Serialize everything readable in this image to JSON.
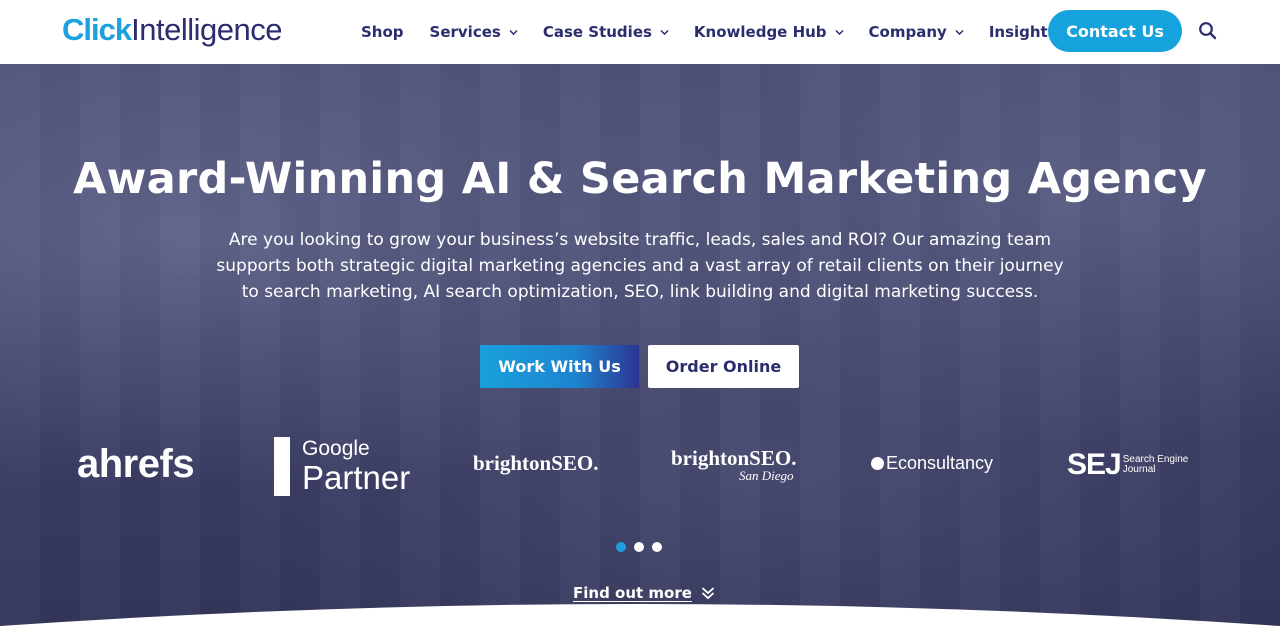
{
  "header": {
    "logo_click": "Click",
    "logo_intel": "Intelligence",
    "nav": [
      {
        "label": "Shop",
        "has_dropdown": false
      },
      {
        "label": "Services",
        "has_dropdown": true
      },
      {
        "label": "Case Studies",
        "has_dropdown": true
      },
      {
        "label": "Knowledge Hub",
        "has_dropdown": true
      },
      {
        "label": "Company",
        "has_dropdown": true
      },
      {
        "label": "Insights",
        "has_dropdown": true
      }
    ],
    "contact_label": "Contact Us",
    "search_icon": "search-icon"
  },
  "hero": {
    "title": "Award-Winning AI & Search Marketing Agency",
    "subtitle": "Are you looking to grow your business’s website traffic, leads, sales and ROI? Our amazing team supports both strategic digital marketing agencies and a vast array of retail clients on their journey to search marketing, AI search optimization, SEO, link building and digital marketing success.",
    "primary_button": "Work With Us",
    "secondary_button": "Order Online",
    "partners": {
      "ahrefs": "ahrefs",
      "google_top": "Google",
      "google_bottom": "Partner",
      "brightonseo": "brightonSEO.",
      "brightonseo_sd_main": "brightonSEO.",
      "brightonseo_sd_sub": "San Diego",
      "econsultancy": "Econsultancy",
      "sej_big": "SEJ",
      "sej_small_1": "Search Engine",
      "sej_small_2": "Journal"
    },
    "carousel": {
      "pages": 3,
      "active": 1
    },
    "find_more": "Find out more"
  },
  "colors": {
    "brand_blue": "#1da1de",
    "brand_navy": "#2b2d6e",
    "hero_overlay": "#3d3f66"
  }
}
